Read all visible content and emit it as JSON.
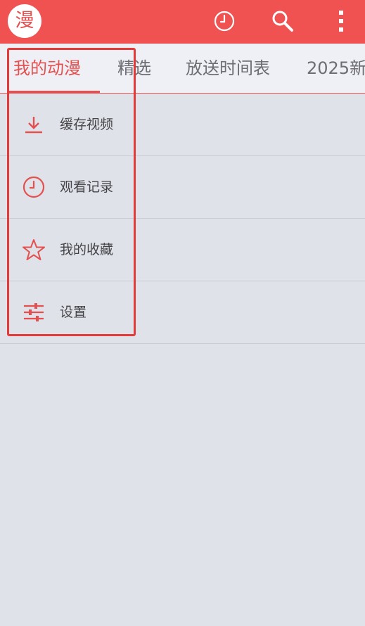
{
  "app": {
    "logo_text": "漫",
    "accent_color": "#f05252"
  },
  "header": {
    "icons": [
      "history-clock-icon",
      "search-icon",
      "more-vertical-icon"
    ]
  },
  "tabs": [
    {
      "label": "我的动漫",
      "active": true
    },
    {
      "label": "精选",
      "active": false
    },
    {
      "label": "放送时间表",
      "active": false
    },
    {
      "label": "2025新",
      "active": false
    }
  ],
  "menu": {
    "items": [
      {
        "label": "缓存视频",
        "icon": "download-icon"
      },
      {
        "label": "观看记录",
        "icon": "clock-icon"
      },
      {
        "label": "我的收藏",
        "icon": "star-icon"
      },
      {
        "label": "设置",
        "icon": "settings-sliders-icon"
      }
    ]
  }
}
